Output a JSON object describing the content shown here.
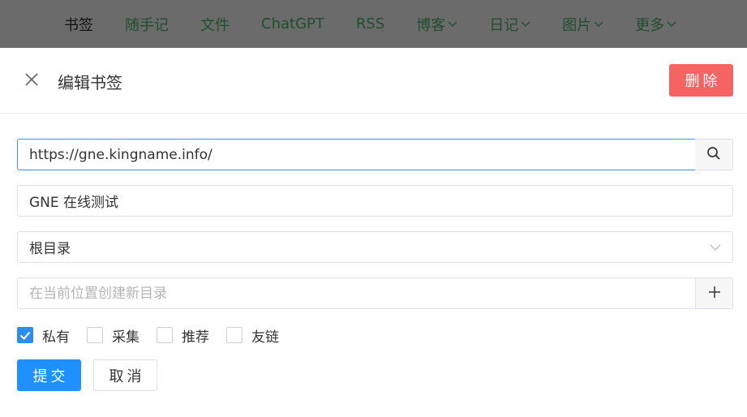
{
  "nav": {
    "items": [
      {
        "label": "书签",
        "active": true,
        "dropdown": false
      },
      {
        "label": "随手记",
        "active": false,
        "dropdown": false
      },
      {
        "label": "文件",
        "active": false,
        "dropdown": false
      },
      {
        "label": "ChatGPT",
        "active": false,
        "dropdown": false
      },
      {
        "label": "RSS",
        "active": false,
        "dropdown": false
      },
      {
        "label": "博客",
        "active": false,
        "dropdown": true
      },
      {
        "label": "日记",
        "active": false,
        "dropdown": true
      },
      {
        "label": "图片",
        "active": false,
        "dropdown": true
      },
      {
        "label": "更多",
        "active": false,
        "dropdown": true
      }
    ]
  },
  "panel": {
    "title": "编辑书签",
    "delete_label": "删除"
  },
  "form": {
    "url_value": "https://gne.kingname.info/",
    "title_value": "GNE 在线测试",
    "folder_value": "根目录",
    "new_dir_placeholder": "在当前位置创建新目录",
    "checkboxes": [
      {
        "label": "私有",
        "checked": true
      },
      {
        "label": "采集",
        "checked": false
      },
      {
        "label": "推荐",
        "checked": false
      },
      {
        "label": "友链",
        "checked": false
      }
    ],
    "submit_label": "提交",
    "cancel_label": "取消"
  },
  "colors": {
    "delete": "#f56363",
    "primary": "#1e90ff",
    "checkbox": "#2d8cf0",
    "nav_overlay": "#6b6b6b"
  },
  "icons": {
    "close": "close-icon",
    "search": "search-icon",
    "add": "plus-icon",
    "chevron": "chevron-down-icon"
  }
}
